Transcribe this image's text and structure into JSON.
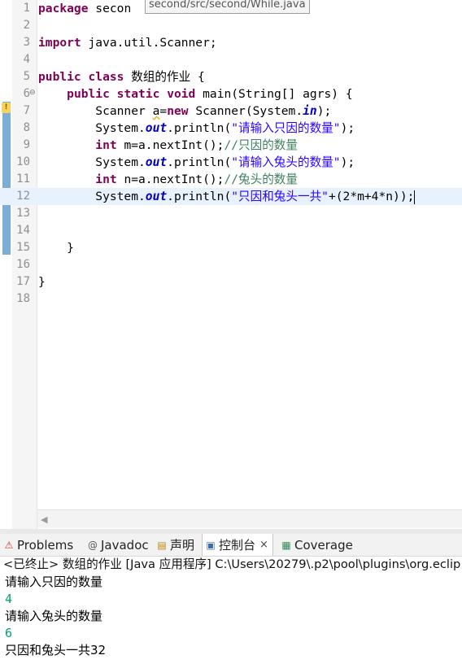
{
  "tooltip": "second/src/second/While.java",
  "editor": {
    "line_numbers": [
      "1",
      "2",
      "3",
      "4",
      "5",
      "6",
      "7",
      "8",
      "9",
      "10",
      "11",
      "12",
      "13",
      "14",
      "15",
      "16",
      "17",
      "18"
    ],
    "fold_marker": "⊖",
    "code": {
      "l1_kw": "package",
      "l1_rest": " secon",
      "l3_kw": "import",
      "l3_rest": " java.util.Scanner;",
      "l5_kw1": "public",
      "l5_kw2": "class",
      "l5_rest": " 数组的作业 {",
      "l6_indent": "    ",
      "l6_kw1": "public",
      "l6_kw2": "static",
      "l6_kw3": "void",
      "l6_rest": " main(String[] agrs) {",
      "l7_a": "        Scanner ",
      "l7_sq": "a",
      "l7_b": "=",
      "l7_kw": "new",
      "l7_c": " Scanner(System.",
      "l7_fld": "in",
      "l7_d": ");",
      "l8_a": "        System.",
      "l8_fld": "out",
      "l8_b": ".println(",
      "l8_str": "\"请输入只因的数量\"",
      "l8_c": ");",
      "l9_indent": "        ",
      "l9_kw": "int",
      "l9_rest": " m=a.nextInt();",
      "l9_cmt": "//只因的数量",
      "l10_a": "        System.",
      "l10_fld": "out",
      "l10_b": ".println(",
      "l10_str": "\"请输入兔头的数量\"",
      "l10_c": ");",
      "l11_indent": "        ",
      "l11_kw": "int",
      "l11_rest": " n=a.nextInt();",
      "l11_cmt": "//兔头的数量",
      "l12_a": "        System.",
      "l12_fld": "out",
      "l12_b": ".println(",
      "l12_str": "\"只因和兔头一共\"",
      "l12_c": "+(2*m+4*n));",
      "l15": "    }",
      "l17": "}"
    }
  },
  "tabs": [
    {
      "label": "Problems",
      "icon": "problems-icon"
    },
    {
      "label": "Javadoc",
      "icon": "at-icon"
    },
    {
      "label": "声明",
      "icon": "declaration-icon"
    },
    {
      "label": "控制台",
      "icon": "console-icon"
    },
    {
      "label": "Coverage",
      "icon": "coverage-icon"
    }
  ],
  "console": {
    "header": "<已终止> 数组的作业 [Java 应用程序] C:\\Users\\20279\\.p2\\pool\\plugins\\org.eclip",
    "lines": [
      {
        "text": "请输入只因的数量",
        "kind": "output"
      },
      {
        "text": "4",
        "kind": "input"
      },
      {
        "text": "请输入兔头的数量",
        "kind": "output"
      },
      {
        "text": "6",
        "kind": "input"
      },
      {
        "text": "只因和兔头一共32",
        "kind": "output"
      }
    ]
  },
  "colors": {
    "keyword": "#7f0055",
    "string": "#2a00ff",
    "comment": "#3f7f5f",
    "field": "#0000c0",
    "console_input": "#00a277",
    "current_line": "#e8f2fe"
  }
}
